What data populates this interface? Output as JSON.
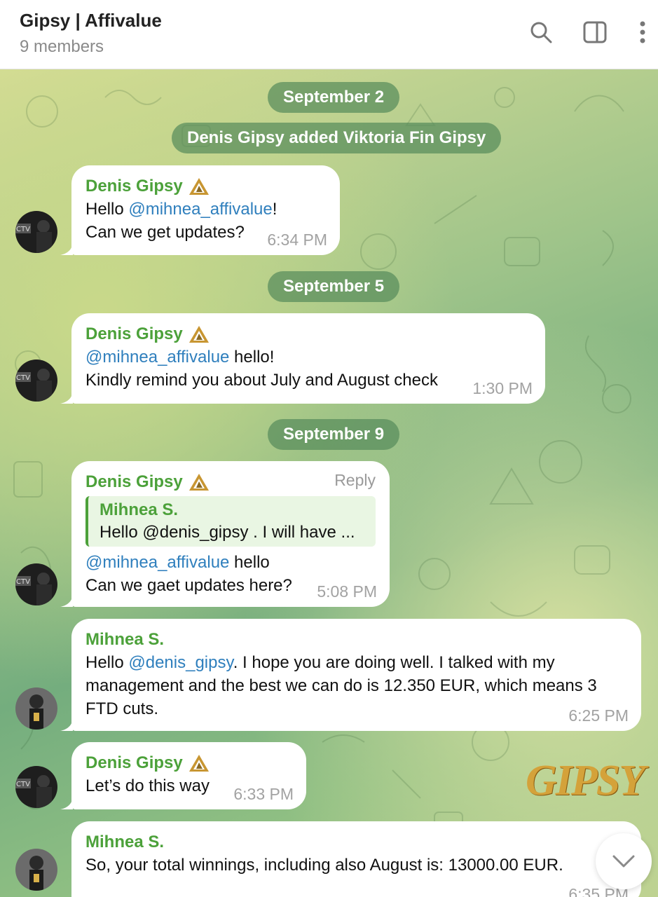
{
  "header": {
    "title": "Gipsy | Affivalue",
    "subtitle": "9 members",
    "icons": [
      "search-icon",
      "sidebar-panel-icon",
      "more-vertical-icon"
    ]
  },
  "dates": {
    "d1": "September 2",
    "d2": "September 5",
    "d3": "September 9"
  },
  "service": "Denis Gipsy added Viktoria Fin Gipsy",
  "messages": [
    {
      "sender": "Denis Gipsy",
      "mention": "@mihnea_affivalue",
      "line1_pre": "Hello ",
      "line1_post": "!",
      "line2": "Can we get updates?",
      "time": "6:34 PM"
    },
    {
      "sender": "Denis Gipsy",
      "mention": "@mihnea_affivalue",
      "line1_post": " hello!",
      "line2": "Kindly remind you about July and August check",
      "time": "1:30 PM"
    },
    {
      "sender": "Denis Gipsy",
      "reply_label": "Reply",
      "quote_name": "Mihnea S.",
      "quote_text": "Hello @denis_gipsy . I will have ...",
      "mention": "@mihnea_affivalue",
      "line1_post": " hello",
      "line2": "Can we gaet updates here?",
      "time": "5:08 PM"
    },
    {
      "sender": "Mihnea S.",
      "line1_pre": "Hello ",
      "mention": "@denis_gipsy",
      "line1_post": ". I hope you are doing well. I talked with my",
      "line2": "management and the best we can do is 12.350 EUR, which means 3",
      "line3": "FTD cuts.",
      "time": "6:25 PM"
    },
    {
      "sender": "Denis Gipsy",
      "line1": "Let’s do this way",
      "time": "6:33 PM"
    },
    {
      "sender": "Mihnea S.",
      "line1": "So, your total winnings, including also August is: 13000.00 EUR.",
      "time": "6:35 PM"
    }
  ],
  "watermark": "GIPSY",
  "colors": {
    "sender_name": "#4ca13a",
    "mention": "#2f7fbd",
    "date_pill": "#588c5c"
  }
}
